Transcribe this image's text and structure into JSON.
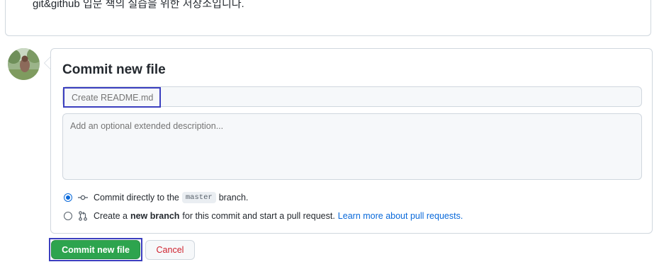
{
  "readme": {
    "description": "git&github 입문 책의 실습을 위한 저장소입니다."
  },
  "commit": {
    "title": "Commit new file",
    "summary_placeholder": "Create README.md",
    "description_placeholder": "Add an optional extended description...",
    "option_direct": {
      "prefix": "Commit directly to the",
      "branch": "master",
      "suffix": "branch.",
      "selected": true
    },
    "option_new_branch": {
      "prefix": "Create a",
      "bold": "new branch",
      "suffix": "for this commit and start a pull request.",
      "link": "Learn more about pull requests.",
      "selected": false
    }
  },
  "buttons": {
    "commit_label": "Commit new file",
    "cancel_label": "Cancel"
  },
  "colors": {
    "primary_green": "#2da44e",
    "link_blue": "#0969da",
    "danger_red": "#cf222e",
    "highlight_outline": "#3b3fbf"
  },
  "icons": {
    "commit": "git-commit-icon",
    "pull_request": "git-pull-request-icon",
    "avatar": "user-avatar"
  }
}
